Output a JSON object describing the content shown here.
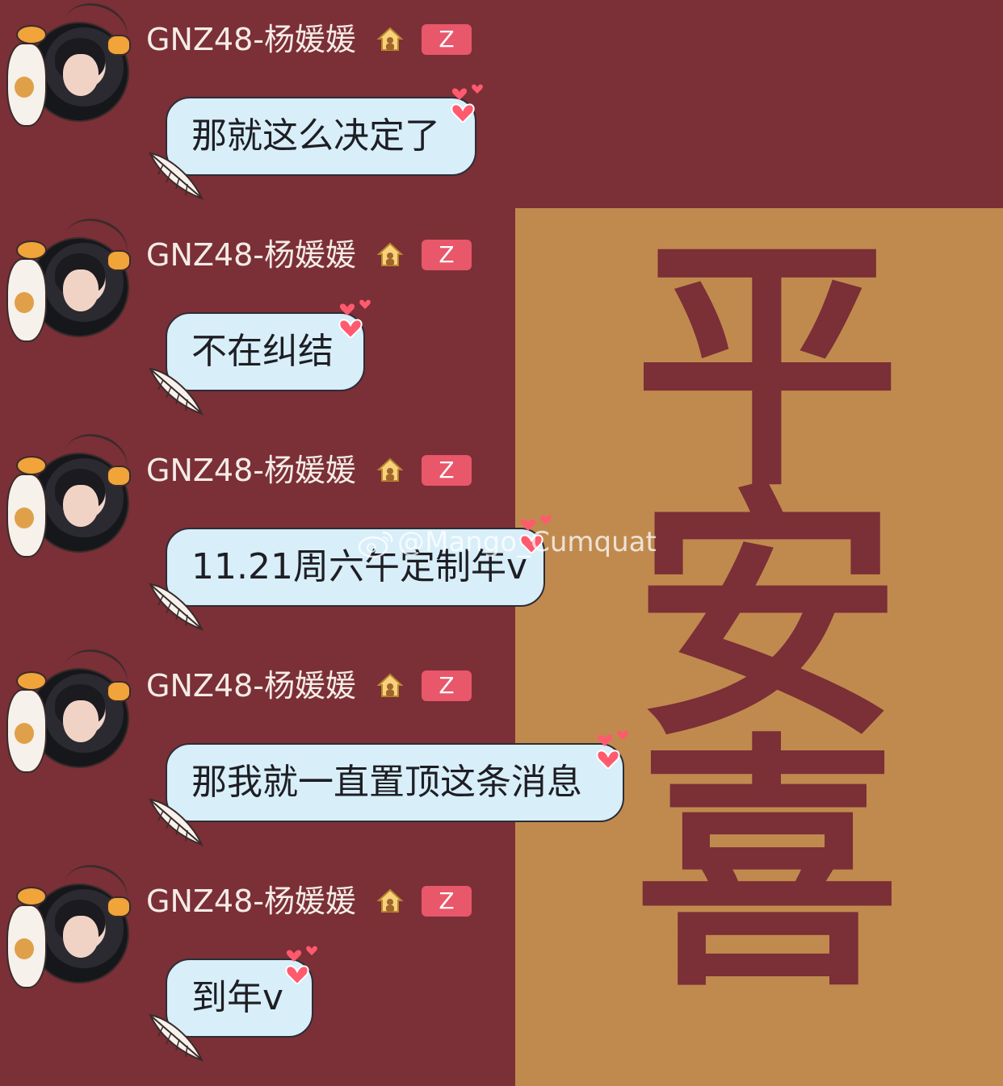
{
  "background": {
    "panel_text": [
      "平",
      "安",
      "喜"
    ],
    "colors": {
      "base": "#7b2f36",
      "panel": "#c08a4f",
      "bubble": "#d8eef9",
      "badge": "#e8576a"
    }
  },
  "messages": [
    {
      "username": "GNZ48-杨媛媛",
      "badge": "Z",
      "text": "那就这么决定了"
    },
    {
      "username": "GNZ48-杨媛媛",
      "badge": "Z",
      "text": "不在纠结"
    },
    {
      "username": "GNZ48-杨媛媛",
      "badge": "Z",
      "text": "11.21周六午定制年v"
    },
    {
      "username": "GNZ48-杨媛媛",
      "badge": "Z",
      "text": "那我就一直置顶这条消息"
    },
    {
      "username": "GNZ48-杨媛媛",
      "badge": "Z",
      "text": "到年v"
    }
  ],
  "watermark": {
    "text": "@Mango_Cumquat",
    "icon": "weibo-logo-icon"
  },
  "icons": {
    "house": "house-icon",
    "feather": "feather-icon",
    "hearts": "hearts-icon",
    "avatar_deco": "cat-fish-deco"
  }
}
